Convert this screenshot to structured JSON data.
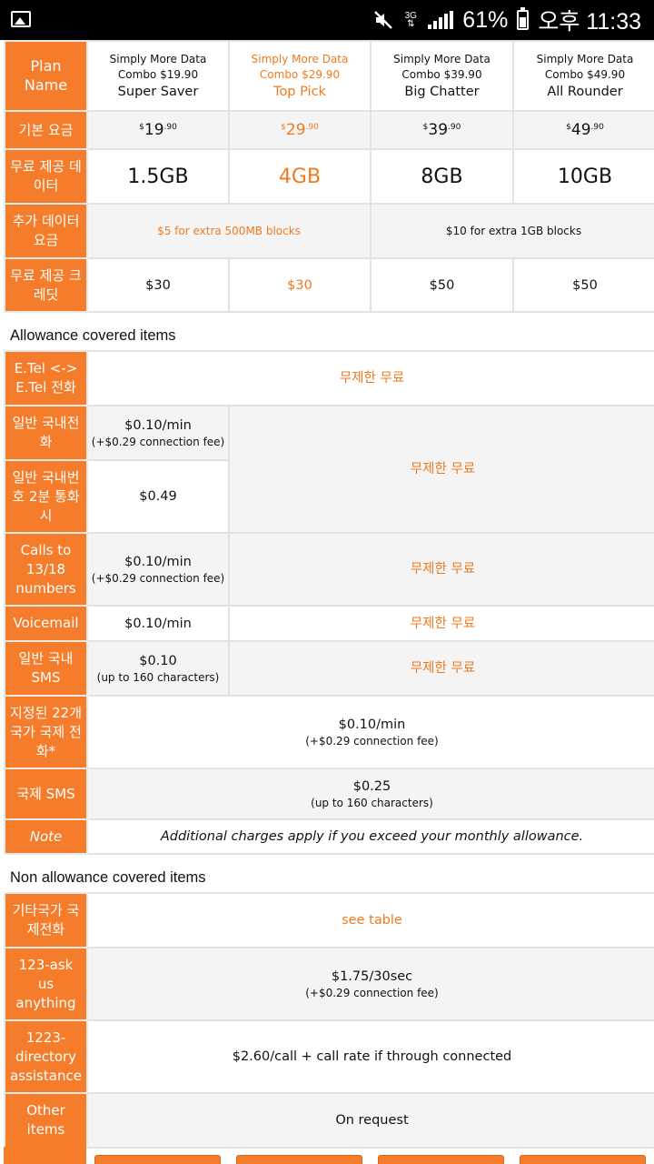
{
  "status_bar": {
    "battery": "61%",
    "time": "오후 11:33",
    "network": "3G"
  },
  "plans": {
    "header_label": "Plan Name",
    "items": [
      {
        "line1": "Simply More Data",
        "line2": "Combo $19.90",
        "name": "Super Saver",
        "price_main": "19",
        "price_cents": ".90",
        "data": "1.5GB",
        "credit": "$30"
      },
      {
        "line1": "Simply More Data",
        "line2": "Combo $29.90",
        "name": "Top Pick",
        "price_main": "29",
        "price_cents": ".90",
        "data": "4GB",
        "credit": "$30"
      },
      {
        "line1": "Simply More Data",
        "line2": "Combo $39.90",
        "name": "Big Chatter",
        "price_main": "39",
        "price_cents": ".90",
        "data": "8GB",
        "credit": "$50"
      },
      {
        "line1": "Simply More Data",
        "line2": "Combo $49.90",
        "name": "All Rounder",
        "price_main": "49",
        "price_cents": ".90",
        "data": "10GB",
        "credit": "$50"
      }
    ],
    "price_label": "기본 요금",
    "currency": "$",
    "data_label": "무료 제공 데이터",
    "extra_label": "추가 데이터 요금",
    "extra_left": "$5 for extra 500MB blocks",
    "extra_right": "$10 for extra 1GB blocks",
    "credit_label": "무료 제공 크레딧"
  },
  "allowance": {
    "title": "Allowance covered items",
    "etel_label": "E.Tel <-> E.Tel 전화",
    "etel_value": "무제한 무료",
    "local_label": "일반 국내전화",
    "local_value": "$0.10/min",
    "local_fee": "(+$0.29 connection fee)",
    "twomin_label": "일반 국내번호 2분 통화시",
    "twomin_value": "$0.49",
    "merged_value": "무제한 무료",
    "calls1318_label": "Calls to 13/18 numbers",
    "calls1318_value": "$0.10/min",
    "calls1318_fee": "(+$0.29 connection fee)",
    "calls1318_free": "무제한 무료",
    "voicemail_label": "Voicemail",
    "voicemail_value": "$0.10/min",
    "voicemail_free": "무제한 무료",
    "sms_label": "일반 국내 SMS",
    "sms_value": "$0.10",
    "sms_note": "(up to 160 characters)",
    "sms_free": "무제한 무료",
    "intl22_label": "지정된 22개국가 국제 전화*",
    "intl22_value": "$0.10/min",
    "intl22_fee": "(+$0.29 connection fee)",
    "intlsms_label": "국제 SMS",
    "intlsms_value": "$0.25",
    "intlsms_note": "(up to 160 characters)",
    "note_label": "Note",
    "note_value": "Additional charges apply if you exceed your monthly allowance."
  },
  "non_allowance": {
    "title": "Non allowance covered items",
    "other_intl_label": "기타국가 국제전화",
    "other_intl_value": "see table",
    "ask_label": "123-ask us anything",
    "ask_value": "$1.75/30sec",
    "ask_fee": "(+$0.29 connection fee)",
    "directory_label": "1223-directory assistance",
    "directory_value": "$2.60/call + call rate if through connected",
    "other_items_label": "Other items",
    "other_items_value": "On request"
  },
  "colors": {
    "accent": "#f47c2a",
    "highlight_text": "#f07a1e",
    "row_gray": "#f4f4f4"
  }
}
